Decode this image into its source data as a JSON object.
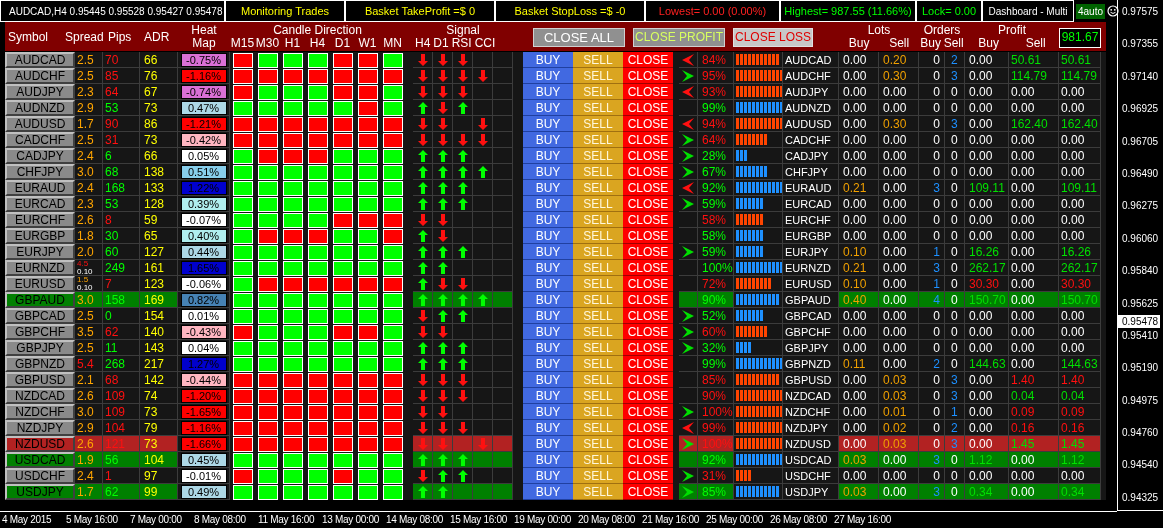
{
  "title_bar": {
    "chart_title": "AUDCAD,H4  0.95445 0.95528 0.95427 0.95478",
    "panels": [
      {
        "text": "Monitoring Trades",
        "kind": "info"
      },
      {
        "text": "Basket TakeProfit =$ 0",
        "kind": "info"
      },
      {
        "text": "Basket StopLoss =$ -0",
        "kind": "info"
      },
      {
        "text": "Lowest= 0.00 (0.00%)",
        "kind": "loss"
      },
      {
        "text": "Highest= 987.55 (11.66%)",
        "kind": "gain"
      },
      {
        "text": "Lock= 0.00",
        "kind": "gain"
      },
      {
        "text": "Dashboard - Multi",
        "kind": "plain"
      }
    ],
    "mode": "4auto"
  },
  "header": {
    "symbol": "Symbol",
    "spread": "Spread",
    "pips": "Pips",
    "adr": "ADR",
    "heat_map": "Heat Map",
    "candle_direction": "Candle Direction",
    "timeframes": [
      "M15",
      "M30",
      "H1",
      "H4",
      "D1",
      "W1",
      "MN"
    ],
    "signal": "Signal",
    "signal_columns": [
      "H4",
      "D1",
      "RSI",
      "CCI"
    ],
    "close_all": "CLOSE ALL",
    "close_profit": "CLOSE PROFIT",
    "close_loss": "CLOSE LOSS",
    "lots": "Lots",
    "lots_buy": "Buy",
    "lots_sell": "Sell",
    "orders": "Orders",
    "orders_buy": "Buy",
    "orders_sell": "Sell",
    "profit": "Profit",
    "profit_buy": "Buy",
    "profit_sell": "Sell",
    "balance": "981.67"
  },
  "rows": [
    {
      "symbol": "AUDCAD",
      "spread": "2.5",
      "spread_high": false,
      "pips": "70",
      "pips_up": false,
      "adr": "66",
      "heat": {
        "text": "-0.75%",
        "color": "#da70d6"
      },
      "candles": [
        false,
        true,
        true,
        true,
        false,
        false,
        true
      ],
      "signals": [
        {
          "kind": "down"
        },
        {
          "kind": "down"
        },
        {
          "kind": "down"
        },
        {
          "kind": "empty"
        }
      ],
      "actions": [
        "BUY",
        "SELL",
        "CLOSE"
      ],
      "arrow": {
        "kind": "left"
      },
      "strength": "84%",
      "up": false,
      "level": 0.92,
      "symbol_label": "AUDCAD",
      "lots_buy": "0.00",
      "lots_sell": "0.20",
      "orders_buy": "0",
      "orders_sell": "2",
      "profit_buy": "0.00",
      "profit_sell": "50.61",
      "total": "50.61",
      "buy_open": false,
      "sell_open": true,
      "loss": false
    },
    {
      "symbol": "AUDCHF",
      "spread": "2.5",
      "spread_high": false,
      "pips": "85",
      "pips_up": false,
      "adr": "76",
      "heat": {
        "text": "-1.16%",
        "color": "#ff0000"
      },
      "candles": [
        false,
        false,
        false,
        false,
        false,
        false,
        false
      ],
      "signals": [
        {
          "kind": "down"
        },
        {
          "kind": "down"
        },
        {
          "kind": "down"
        },
        {
          "kind": "down"
        }
      ],
      "actions": [
        "BUY",
        "SELL",
        "CLOSE"
      ],
      "arrow": {
        "kind": "right"
      },
      "strength": "95%",
      "up": false,
      "level": 1,
      "symbol_label": "AUDCHF",
      "lots_buy": "0.00",
      "lots_sell": "0.30",
      "orders_buy": "0",
      "orders_sell": "3",
      "profit_buy": "0.00",
      "profit_sell": "114.79",
      "total": "114.79",
      "buy_open": false,
      "sell_open": true,
      "loss": false
    },
    {
      "symbol": "AUDJPY",
      "spread": "2.3",
      "spread_high": false,
      "pips": "64",
      "pips_up": false,
      "adr": "67",
      "heat": {
        "text": "-0.74%",
        "color": "#da70d6"
      },
      "candles": [
        false,
        true,
        true,
        true,
        false,
        false,
        true
      ],
      "signals": [
        {
          "kind": "down"
        },
        {
          "kind": "down"
        },
        {
          "kind": "down"
        },
        {
          "kind": "empty"
        }
      ],
      "actions": [
        "BUY",
        "SELL",
        "CLOSE"
      ],
      "arrow": {
        "kind": "left"
      },
      "strength": "93%",
      "up": false,
      "level": 1,
      "symbol_label": "AUDJPY",
      "lots_buy": "0.00",
      "lots_sell": "0.00",
      "orders_buy": "0",
      "orders_sell": "0",
      "profit_buy": "0.00",
      "profit_sell": "0.00",
      "total": "0.00",
      "buy_open": false,
      "sell_open": false,
      "loss": false
    },
    {
      "symbol": "AUDNZD",
      "spread": "2.9",
      "spread_high": false,
      "pips": "53",
      "pips_up": true,
      "adr": "73",
      "heat": {
        "text": "0.47%",
        "color": "#add8e6"
      },
      "candles": [
        true,
        true,
        true,
        true,
        true,
        false,
        true
      ],
      "signals": [
        {
          "kind": "up"
        },
        {
          "kind": "down"
        },
        {
          "kind": "up"
        },
        {
          "kind": "empty"
        }
      ],
      "actions": [
        "BUY",
        "SELL",
        "CLOSE"
      ],
      "strength": "99%",
      "up": true,
      "level": 1,
      "symbol_label": "AUDNZD",
      "lots_buy": "0.00",
      "lots_sell": "0.00",
      "orders_buy": "0",
      "orders_sell": "0",
      "profit_buy": "0.00",
      "profit_sell": "0.00",
      "total": "0.00",
      "buy_open": false,
      "sell_open": false,
      "loss": false
    },
    {
      "symbol": "AUDUSD",
      "spread": "1.7",
      "spread_high": false,
      "pips": "90",
      "pips_up": false,
      "adr": "86",
      "heat": {
        "text": "-1.21%",
        "color": "#ff0000"
      },
      "candles": [
        false,
        false,
        false,
        false,
        false,
        false,
        false
      ],
      "signals": [
        {
          "kind": "down"
        },
        {
          "kind": "down"
        },
        {
          "kind": "empty"
        },
        {
          "kind": "down"
        }
      ],
      "actions": [
        "BUY",
        "SELL",
        "CLOSE"
      ],
      "arrow": {
        "kind": "left"
      },
      "strength": "94%",
      "up": false,
      "level": 1,
      "symbol_label": "AUDUSD",
      "lots_buy": "0.00",
      "lots_sell": "0.30",
      "orders_buy": "0",
      "orders_sell": "3",
      "profit_buy": "0.00",
      "profit_sell": "162.40",
      "total": "162.40",
      "buy_open": false,
      "sell_open": true,
      "loss": false
    },
    {
      "symbol": "CADCHF",
      "spread": "2.5",
      "spread_high": false,
      "pips": "31",
      "pips_up": false,
      "adr": "73",
      "heat": {
        "text": "-0.42%",
        "color": "#ffb6c1"
      },
      "candles": [
        false,
        false,
        false,
        false,
        false,
        false,
        false
      ],
      "signals": [
        {
          "kind": "down"
        },
        {
          "kind": "down"
        },
        {
          "kind": "down"
        },
        {
          "kind": "down"
        }
      ],
      "actions": [
        "BUY",
        "SELL",
        "CLOSE"
      ],
      "arrow": {
        "kind": "right"
      },
      "strength": "64%",
      "up": false,
      "level": 0.67,
      "symbol_label": "CADCHF",
      "lots_buy": "0.00",
      "lots_sell": "0.00",
      "orders_buy": "0",
      "orders_sell": "0",
      "profit_buy": "0.00",
      "profit_sell": "0.00",
      "total": "0.00",
      "buy_open": false,
      "sell_open": false,
      "loss": false
    },
    {
      "symbol": "CADJPY",
      "spread": "2.4",
      "spread_high": false,
      "pips": "6",
      "pips_up": true,
      "adr": "66",
      "heat": {
        "text": "0.05%",
        "color": "#ffffff"
      },
      "candles": [
        true,
        false,
        false,
        false,
        true,
        true,
        true
      ],
      "signals": [
        {
          "kind": "up"
        },
        {
          "kind": "up"
        },
        {
          "kind": "up"
        },
        {
          "kind": "empty"
        }
      ],
      "actions": [
        "BUY",
        "SELL",
        "CLOSE"
      ],
      "arrow": {
        "kind": "right"
      },
      "strength": "28%",
      "up": true,
      "level": 0.25,
      "symbol_label": "CADJPY",
      "lots_buy": "0.00",
      "lots_sell": "0.00",
      "orders_buy": "0",
      "orders_sell": "0",
      "profit_buy": "0.00",
      "profit_sell": "0.00",
      "total": "0.00",
      "buy_open": false,
      "sell_open": false,
      "loss": false
    },
    {
      "symbol": "CHFJPY",
      "spread": "3.0",
      "spread_high": false,
      "pips": "68",
      "pips_up": true,
      "adr": "138",
      "heat": {
        "text": "0.51%",
        "color": "#87ceeb"
      },
      "candles": [
        true,
        true,
        true,
        true,
        true,
        true,
        true
      ],
      "signals": [
        {
          "kind": "up"
        },
        {
          "kind": "up"
        },
        {
          "kind": "up"
        },
        {
          "kind": "up"
        }
      ],
      "actions": [
        "BUY",
        "SELL",
        "CLOSE"
      ],
      "arrow": {
        "kind": "right"
      },
      "strength": "67%",
      "up": true,
      "level": 0.67,
      "symbol_label": "CHFJPY",
      "lots_buy": "0.00",
      "lots_sell": "0.00",
      "orders_buy": "0",
      "orders_sell": "0",
      "profit_buy": "0.00",
      "profit_sell": "0.00",
      "total": "0.00",
      "buy_open": false,
      "sell_open": false,
      "loss": false
    },
    {
      "symbol": "EURAUD",
      "spread": "2.4",
      "spread_high": false,
      "pips": "168",
      "pips_up": true,
      "adr": "133",
      "heat": {
        "text": "1.22%",
        "color": "#0000cd"
      },
      "candles": [
        true,
        true,
        true,
        true,
        true,
        true,
        true
      ],
      "signals": [
        {
          "kind": "up"
        },
        {
          "kind": "up"
        },
        {
          "kind": "up"
        },
        {
          "kind": "empty"
        }
      ],
      "actions": [
        "BUY",
        "SELL",
        "CLOSE"
      ],
      "arrow": {
        "kind": "left"
      },
      "strength": "92%",
      "up": true,
      "level": 1,
      "symbol_label": "EURAUD",
      "lots_buy": "0.21",
      "lots_sell": "0.00",
      "orders_buy": "3",
      "orders_sell": "0",
      "profit_buy": "109.11",
      "profit_sell": "0.00",
      "total": "109.11",
      "buy_open": true,
      "sell_open": false,
      "loss": false
    },
    {
      "symbol": "EURCAD",
      "spread": "2.3",
      "spread_high": false,
      "pips": "53",
      "pips_up": true,
      "adr": "128",
      "heat": {
        "text": "0.39%",
        "color": "#afeeee"
      },
      "candles": [
        true,
        true,
        true,
        true,
        true,
        true,
        true
      ],
      "signals": [
        {
          "kind": "up"
        },
        {
          "kind": "up"
        },
        {
          "kind": "up"
        },
        {
          "kind": "empty"
        }
      ],
      "actions": [
        "BUY",
        "SELL",
        "CLOSE"
      ],
      "arrow": {
        "kind": "right"
      },
      "strength": "59%",
      "up": true,
      "level": 0.58,
      "symbol_label": "EURCAD",
      "lots_buy": "0.00",
      "lots_sell": "0.00",
      "orders_buy": "0",
      "orders_sell": "0",
      "profit_buy": "0.00",
      "profit_sell": "0.00",
      "total": "0.00",
      "buy_open": false,
      "sell_open": false,
      "loss": false
    },
    {
      "symbol": "EURCHF",
      "spread": "2.6",
      "spread_high": false,
      "pips": "8",
      "pips_up": false,
      "adr": "59",
      "heat": {
        "text": "-0.07%",
        "color": "#ffffff"
      },
      "candles": [
        true,
        true,
        true,
        true,
        false,
        false,
        false
      ],
      "signals": [
        {
          "kind": "down"
        },
        {
          "kind": "down"
        },
        {
          "kind": "empty"
        },
        {
          "kind": "empty"
        }
      ],
      "actions": [
        "BUY",
        "SELL",
        "CLOSE"
      ],
      "strength": "58%",
      "up": false,
      "level": 0.58,
      "symbol_label": "EURCHF",
      "lots_buy": "0.00",
      "lots_sell": "0.00",
      "orders_buy": "0",
      "orders_sell": "0",
      "profit_buy": "0.00",
      "profit_sell": "0.00",
      "total": "0.00",
      "buy_open": false,
      "sell_open": false,
      "loss": false
    },
    {
      "symbol": "EURGBP",
      "spread": "1.8",
      "spread_high": false,
      "pips": "30",
      "pips_up": true,
      "adr": "65",
      "heat": {
        "text": "0.40%",
        "color": "#afeeee"
      },
      "candles": [
        true,
        false,
        false,
        false,
        true,
        true,
        false
      ],
      "signals": [
        {
          "kind": "up"
        },
        {
          "kind": "down"
        },
        {
          "kind": "empty"
        },
        {
          "kind": "empty"
        }
      ],
      "actions": [
        "BUY",
        "SELL",
        "CLOSE"
      ],
      "strength": "58%",
      "up": true,
      "level": 0.58,
      "symbol_label": "EURGBP",
      "lots_buy": "0.00",
      "lots_sell": "0.00",
      "orders_buy": "0",
      "orders_sell": "0",
      "profit_buy": "0.00",
      "profit_sell": "0.00",
      "total": "0.00",
      "buy_open": false,
      "sell_open": false,
      "loss": false
    },
    {
      "symbol": "EURJPY",
      "spread": "2.0",
      "spread_high": false,
      "pips": "60",
      "pips_up": true,
      "adr": "127",
      "heat": {
        "text": "0.44%",
        "color": "#add8e6"
      },
      "candles": [
        true,
        true,
        true,
        true,
        true,
        true,
        true
      ],
      "signals": [
        {
          "kind": "up"
        },
        {
          "kind": "up"
        },
        {
          "kind": "up"
        },
        {
          "kind": "empty"
        }
      ],
      "actions": [
        "BUY",
        "SELL",
        "CLOSE"
      ],
      "arrow": {
        "kind": "right"
      },
      "strength": "59%",
      "up": true,
      "level": 0.58,
      "symbol_label": "EURJPY",
      "lots_buy": "0.10",
      "lots_sell": "0.00",
      "orders_buy": "1",
      "orders_sell": "0",
      "profit_buy": "16.26",
      "profit_sell": "0.00",
      "total": "16.26",
      "buy_open": true,
      "sell_open": false,
      "loss": false
    },
    {
      "symbol": "EURNZD",
      "spread": "4.5",
      "spread_high": true,
      "overlay": "0.10",
      "pips": "249",
      "pips_up": true,
      "adr": "161",
      "heat": {
        "text": "1.65%",
        "color": "#0000cd"
      },
      "candles": [
        true,
        true,
        true,
        true,
        true,
        true,
        true
      ],
      "signals": [
        {
          "kind": "up"
        },
        {
          "kind": "up"
        },
        {
          "kind": "empty"
        },
        {
          "kind": "empty"
        }
      ],
      "actions": [
        "BUY",
        "SELL",
        "CLOSE"
      ],
      "strength": "100%",
      "up": true,
      "level": 1,
      "symbol_label": "EURNZD",
      "lots_buy": "0.21",
      "lots_sell": "0.00",
      "orders_buy": "3",
      "orders_sell": "0",
      "profit_buy": "262.17",
      "profit_sell": "0.00",
      "total": "262.17",
      "buy_open": true,
      "sell_open": false,
      "loss": false
    },
    {
      "symbol": "EURUSD",
      "spread": "1.5",
      "spread_high": false,
      "overlay": "0.10",
      "pips": "7",
      "pips_up": false,
      "adr": "123",
      "heat": {
        "text": "-0.06%",
        "color": "#ffffff"
      },
      "candles": [
        true,
        false,
        false,
        false,
        false,
        false,
        false
      ],
      "signals": [
        {
          "kind": "up"
        },
        {
          "kind": "down"
        },
        {
          "kind": "down"
        },
        {
          "kind": "empty"
        }
      ],
      "actions": [
        "BUY",
        "SELL",
        "CLOSE"
      ],
      "strength": "72%",
      "up": false,
      "level": 0.75,
      "symbol_label": "EURUSD",
      "lots_buy": "0.10",
      "lots_sell": "0.00",
      "orders_buy": "1",
      "orders_sell": "0",
      "profit_buy": "30.30",
      "profit_sell": "0.00",
      "total": "30.30",
      "buy_open": true,
      "sell_open": false,
      "loss": true
    },
    {
      "symbol": "GBPAUD",
      "spread": "3.0",
      "spread_high": false,
      "pips": "158",
      "pips_up": true,
      "adr": "169",
      "heat": {
        "text": "0.82%",
        "color": "#4682b4"
      },
      "candles": [
        true,
        true,
        true,
        true,
        true,
        true,
        true
      ],
      "signals": [
        {
          "kind": "up"
        },
        {
          "kind": "up"
        },
        {
          "kind": "up"
        },
        {
          "kind": "up"
        }
      ],
      "actions": [
        "BUY",
        "SELL",
        "CLOSE"
      ],
      "strength": "90%",
      "up": true,
      "level": 0.92,
      "symbol_label": "GBPAUD",
      "lots_buy": "0.40",
      "lots_sell": "0.00",
      "orders_buy": "4",
      "orders_sell": "0",
      "profit_buy": "150.70",
      "profit_sell": "0.00",
      "total": "150.70",
      "buy_open": true,
      "sell_open": false,
      "loss": false,
      "color": "#008000"
    },
    {
      "symbol": "GBPCAD",
      "spread": "2.5",
      "spread_high": false,
      "pips": "0",
      "pips_up": true,
      "adr": "154",
      "heat": {
        "text": "0.01%",
        "color": "#ffffff"
      },
      "candles": [
        true,
        true,
        true,
        true,
        true,
        true,
        true
      ],
      "signals": [
        {
          "kind": "down"
        },
        {
          "kind": "up"
        },
        {
          "kind": "up"
        },
        {
          "kind": "empty"
        }
      ],
      "actions": [
        "BUY",
        "SELL",
        "CLOSE"
      ],
      "arrow": {
        "kind": "right"
      },
      "strength": "52%",
      "up": true,
      "level": 0.58,
      "symbol_label": "GBPCAD",
      "lots_buy": "0.00",
      "lots_sell": "0.00",
      "orders_buy": "0",
      "orders_sell": "0",
      "profit_buy": "0.00",
      "profit_sell": "0.00",
      "total": "0.00",
      "buy_open": false,
      "sell_open": false,
      "loss": false
    },
    {
      "symbol": "GBPCHF",
      "spread": "3.5",
      "spread_high": false,
      "pips": "62",
      "pips_up": false,
      "adr": "140",
      "heat": {
        "text": "-0.43%",
        "color": "#ffb6c1"
      },
      "candles": [
        false,
        true,
        true,
        true,
        false,
        false,
        true
      ],
      "signals": [
        {
          "kind": "down"
        },
        {
          "kind": "down"
        },
        {
          "kind": "empty"
        },
        {
          "kind": "empty"
        }
      ],
      "actions": [
        "BUY",
        "SELL",
        "CLOSE"
      ],
      "arrow": {
        "kind": "right"
      },
      "strength": "60%",
      "up": false,
      "level": 0.67,
      "symbol_label": "GBPCHF",
      "lots_buy": "0.00",
      "lots_sell": "0.00",
      "orders_buy": "0",
      "orders_sell": "0",
      "profit_buy": "0.00",
      "profit_sell": "0.00",
      "total": "0.00",
      "buy_open": false,
      "sell_open": false,
      "loss": false
    },
    {
      "symbol": "GBPJPY",
      "spread": "2.5",
      "spread_high": false,
      "pips": "11",
      "pips_up": true,
      "adr": "143",
      "heat": {
        "text": "0.04%",
        "color": "#ffffff"
      },
      "candles": [
        true,
        true,
        true,
        true,
        true,
        true,
        true
      ],
      "signals": [
        {
          "kind": "up"
        },
        {
          "kind": "up"
        },
        {
          "kind": "up"
        },
        {
          "kind": "empty"
        }
      ],
      "actions": [
        "BUY",
        "SELL",
        "CLOSE"
      ],
      "arrow": {
        "kind": "right"
      },
      "strength": "32%",
      "up": true,
      "level": 0.33,
      "symbol_label": "GBPJPY",
      "lots_buy": "0.00",
      "lots_sell": "0.00",
      "orders_buy": "0",
      "orders_sell": "0",
      "profit_buy": "0.00",
      "profit_sell": "0.00",
      "total": "0.00",
      "buy_open": false,
      "sell_open": false,
      "loss": false
    },
    {
      "symbol": "GBPNZD",
      "spread": "5.4",
      "spread_high": true,
      "pips": "268",
      "pips_up": true,
      "adr": "217",
      "heat": {
        "text": "1.27%",
        "color": "#0000cd"
      },
      "candles": [
        true,
        true,
        true,
        true,
        true,
        true,
        true
      ],
      "signals": [
        {
          "kind": "up"
        },
        {
          "kind": "up"
        },
        {
          "kind": "up"
        },
        {
          "kind": "empty"
        }
      ],
      "actions": [
        "BUY",
        "SELL",
        "CLOSE"
      ],
      "strength": "99%",
      "up": true,
      "level": 1,
      "symbol_label": "GBPNZD",
      "lots_buy": "0.11",
      "lots_sell": "0.00",
      "orders_buy": "2",
      "orders_sell": "0",
      "profit_buy": "144.63",
      "profit_sell": "0.00",
      "total": "144.63",
      "buy_open": true,
      "sell_open": false,
      "loss": false
    },
    {
      "symbol": "GBPUSD",
      "spread": "2.1",
      "spread_high": false,
      "pips": "68",
      "pips_up": false,
      "adr": "142",
      "heat": {
        "text": "-0.44%",
        "color": "#ffb6c1"
      },
      "candles": [
        false,
        false,
        false,
        false,
        false,
        false,
        false
      ],
      "signals": [
        {
          "kind": "down"
        },
        {
          "kind": "down"
        },
        {
          "kind": "down"
        },
        {
          "kind": "empty"
        }
      ],
      "actions": [
        "BUY",
        "SELL",
        "CLOSE"
      ],
      "strength": "85%",
      "up": false,
      "level": 0.92,
      "symbol_label": "GBPUSD",
      "lots_buy": "0.00",
      "lots_sell": "0.03",
      "orders_buy": "0",
      "orders_sell": "3",
      "profit_buy": "0.00",
      "profit_sell": "1.40",
      "total": "1.40",
      "buy_open": false,
      "sell_open": true,
      "loss": true
    },
    {
      "symbol": "NZDCAD",
      "spread": "2.6",
      "spread_high": false,
      "pips": "109",
      "pips_up": false,
      "adr": "74",
      "heat": {
        "text": "-1.20%",
        "color": "#ff0000"
      },
      "candles": [
        false,
        false,
        false,
        false,
        false,
        false,
        false
      ],
      "signals": [
        {
          "kind": "down"
        },
        {
          "kind": "down"
        },
        {
          "kind": "down"
        },
        {
          "kind": "empty"
        }
      ],
      "actions": [
        "BUY",
        "SELL",
        "CLOSE"
      ],
      "strength": "90%",
      "up": false,
      "level": 1,
      "symbol_label": "NZDCAD",
      "lots_buy": "0.00",
      "lots_sell": "0.03",
      "orders_buy": "0",
      "orders_sell": "3",
      "profit_buy": "0.00",
      "profit_sell": "0.04",
      "total": "0.04",
      "buy_open": false,
      "sell_open": true,
      "loss": false
    },
    {
      "symbol": "NZDCHF",
      "spread": "3.0",
      "spread_high": false,
      "pips": "109",
      "pips_up": false,
      "adr": "73",
      "heat": {
        "text": "-1.65%",
        "color": "#ff0000"
      },
      "candles": [
        false,
        false,
        false,
        false,
        false,
        false,
        false
      ],
      "signals": [
        {
          "kind": "down"
        },
        {
          "kind": "down"
        },
        {
          "kind": "empty"
        },
        {
          "kind": "empty"
        }
      ],
      "actions": [
        "BUY",
        "SELL",
        "CLOSE"
      ],
      "arrow": {
        "kind": "right"
      },
      "strength": "100%",
      "up": false,
      "level": 1,
      "symbol_label": "NZDCHF",
      "lots_buy": "0.00",
      "lots_sell": "0.01",
      "orders_buy": "0",
      "orders_sell": "1",
      "profit_buy": "0.00",
      "profit_sell": "0.09",
      "total": "0.09",
      "buy_open": false,
      "sell_open": true,
      "loss": true
    },
    {
      "symbol": "NZDJPY",
      "spread": "2.9",
      "spread_high": false,
      "pips": "104",
      "pips_up": false,
      "adr": "79",
      "heat": {
        "text": "-1.16%",
        "color": "#ff0000"
      },
      "candles": [
        false,
        false,
        false,
        false,
        false,
        false,
        false
      ],
      "signals": [
        {
          "kind": "down"
        },
        {
          "kind": "down"
        },
        {
          "kind": "down"
        },
        {
          "kind": "empty"
        }
      ],
      "actions": [
        "BUY",
        "SELL",
        "CLOSE"
      ],
      "arrow": {
        "kind": "left"
      },
      "strength": "99%",
      "up": false,
      "level": 1,
      "symbol_label": "NZDJPY",
      "lots_buy": "0.00",
      "lots_sell": "0.02",
      "orders_buy": "0",
      "orders_sell": "2",
      "profit_buy": "0.00",
      "profit_sell": "0.16",
      "total": "0.16",
      "buy_open": false,
      "sell_open": true,
      "loss": true
    },
    {
      "symbol": "NZDUSD",
      "spread": "2.6",
      "spread_high": false,
      "pips": "121",
      "pips_up": false,
      "adr": "73",
      "heat": {
        "text": "-1.66%",
        "color": "#ff0000"
      },
      "candles": [
        false,
        false,
        false,
        false,
        false,
        false,
        false
      ],
      "signals": [
        {
          "kind": "down"
        },
        {
          "kind": "down"
        },
        {
          "kind": "empty"
        },
        {
          "kind": "down"
        }
      ],
      "actions": [
        "BUY",
        "SELL",
        "CLOSE"
      ],
      "arrow": {
        "kind": "right"
      },
      "strength": "100%",
      "up": false,
      "level": 1,
      "symbol_label": "NZDUSD",
      "lots_buy": "0.00",
      "lots_sell": "0.03",
      "orders_buy": "0",
      "orders_sell": "3",
      "profit_buy": "0.00",
      "profit_sell": "1.45",
      "total": "1.45",
      "buy_open": false,
      "sell_open": true,
      "loss": false,
      "color": "#b22222"
    },
    {
      "symbol": "USDCAD",
      "spread": "1.9",
      "spread_high": false,
      "pips": "56",
      "pips_up": true,
      "adr": "104",
      "heat": {
        "text": "0.45%",
        "color": "#add8e6"
      },
      "candles": [
        true,
        true,
        true,
        true,
        true,
        true,
        true
      ],
      "signals": [
        {
          "kind": "up"
        },
        {
          "kind": "up"
        },
        {
          "kind": "up"
        },
        {
          "kind": "empty"
        }
      ],
      "actions": [
        "BUY",
        "SELL",
        "CLOSE"
      ],
      "strength": "92%",
      "up": true,
      "level": 1,
      "symbol_label": "USDCAD",
      "lots_buy": "0.03",
      "lots_sell": "0.00",
      "orders_buy": "3",
      "orders_sell": "0",
      "profit_buy": "1.12",
      "profit_sell": "0.00",
      "total": "1.12",
      "buy_open": true,
      "sell_open": false,
      "loss": false,
      "color": "#008000"
    },
    {
      "symbol": "USDCHF",
      "spread": "2.4",
      "spread_high": false,
      "pips": "1",
      "pips_up": false,
      "adr": "97",
      "heat": {
        "text": "-0.01%",
        "color": "#ffffff"
      },
      "candles": [
        false,
        true,
        true,
        true,
        false,
        true,
        true
      ],
      "signals": [
        {
          "kind": "down"
        },
        {
          "kind": "up"
        },
        {
          "kind": "up"
        },
        {
          "kind": "empty"
        }
      ],
      "actions": [
        "BUY",
        "SELL",
        "CLOSE"
      ],
      "arrow": {
        "kind": "right"
      },
      "strength": "31%",
      "up": false,
      "level": 0.33,
      "symbol_label": "USDCHF",
      "lots_buy": "0.00",
      "lots_sell": "0.00",
      "orders_buy": "0",
      "orders_sell": "0",
      "profit_buy": "0.00",
      "profit_sell": "0.00",
      "total": "0.00",
      "buy_open": false,
      "sell_open": false,
      "loss": false
    },
    {
      "symbol": "USDJPY",
      "spread": "1.7",
      "spread_high": false,
      "pips": "62",
      "pips_up": true,
      "adr": "99",
      "heat": {
        "text": "0.49%",
        "color": "#add8e6"
      },
      "candles": [
        true,
        true,
        true,
        true,
        true,
        true,
        true
      ],
      "signals": [
        {
          "kind": "up"
        },
        {
          "kind": "up"
        },
        {
          "kind": "empty"
        },
        {
          "kind": "empty"
        }
      ],
      "actions": [
        "BUY",
        "SELL",
        "CLOSE"
      ],
      "arrow": {
        "kind": "right"
      },
      "strength": "85%",
      "up": true,
      "level": 0.92,
      "symbol_label": "USDJPY",
      "lots_buy": "0.03",
      "lots_sell": "0.00",
      "orders_buy": "3",
      "orders_sell": "0",
      "profit_buy": "0.34",
      "profit_sell": "0.00",
      "total": "0.34",
      "buy_open": true,
      "sell_open": false,
      "loss": false,
      "color": "#008000"
    }
  ],
  "price_axis": {
    "labels": [
      "0.97575",
      "0.97355",
      "0.97140",
      "0.96925",
      "0.96705",
      "0.96490",
      "0.96275",
      "0.96060",
      "0.95840",
      "0.95625",
      "0.95410",
      "0.95190",
      "0.94975",
      "0.94760",
      "0.94540",
      "0.94325"
    ],
    "current": "0.95478"
  },
  "time_axis": [
    "4 May 2015",
    "5 May 16:00",
    "7 May 00:00",
    "8 May 08:00",
    "11 May 16:00",
    "13 May 00:00",
    "14 May 08:00",
    "15 May 16:00",
    "19 May 00:00",
    "20 May 08:00",
    "21 May 16:00",
    "25 May 00:00",
    "26 May 08:00",
    "27 May 16:00"
  ]
}
